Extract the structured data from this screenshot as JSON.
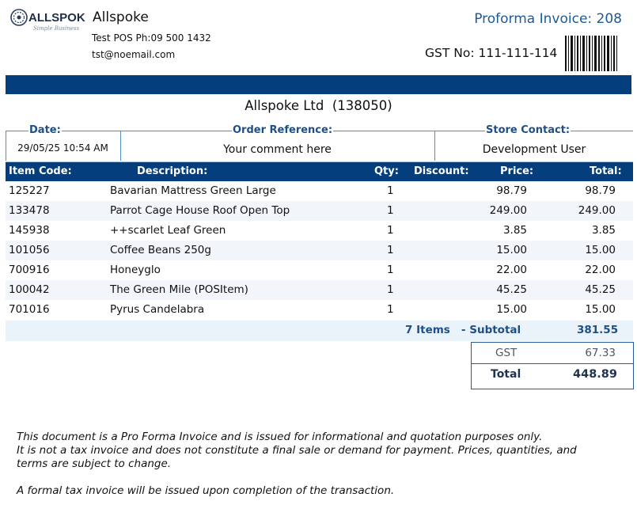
{
  "header": {
    "logo_text": "ALLSPOKE",
    "logo_tagline": "Simple Business",
    "company_name": "Allspoke",
    "phone_line": "Test POS Ph:09 500 1432",
    "email": "tst@noemail.com",
    "invoice_title": "Proforma Invoice: 208",
    "gst_no": "GST No: 111-111-114",
    "barcode_icon": "barcode-icon"
  },
  "customer": {
    "name": "Allspoke Ltd  (138050)"
  },
  "info": {
    "date_label": "Date:",
    "date_value": "29/05/25 10:54 AM",
    "order_ref_label": "Order Reference:",
    "order_ref_value": "Your comment here",
    "store_contact_label": "Store Contact:",
    "store_contact_value": "Development User"
  },
  "table": {
    "headers": {
      "code": "Item Code:",
      "description": "Description:",
      "qty": "Qty:",
      "discount": "Discount:",
      "price": "Price:",
      "total": "Total:"
    },
    "rows": [
      {
        "code": "125227",
        "description": "Bavarian Mattress Green Large",
        "qty": "1",
        "discount": "",
        "price": "98.79",
        "total": "98.79"
      },
      {
        "code": "133478",
        "description": "Parrot Cage House Roof Open Top",
        "qty": "1",
        "discount": "",
        "price": "249.00",
        "total": "249.00"
      },
      {
        "code": "145938",
        "description": "++scarlet Leaf Green",
        "qty": "1",
        "discount": "",
        "price": "3.85",
        "total": "3.85"
      },
      {
        "code": "101056",
        "description": "Coffee Beans 250g",
        "qty": "1",
        "discount": "",
        "price": "15.00",
        "total": "15.00"
      },
      {
        "code": "700916",
        "description": "Honeyglo",
        "qty": "1",
        "discount": "",
        "price": "22.00",
        "total": "22.00"
      },
      {
        "code": "100042",
        "description": "The Green Mile (POSItem)",
        "qty": "1",
        "discount": "",
        "price": "45.25",
        "total": "45.25"
      },
      {
        "code": "701016",
        "description": "Pyrus Candelabra",
        "qty": "1",
        "discount": "",
        "price": "15.00",
        "total": "15.00"
      }
    ]
  },
  "summary": {
    "items_subtotal_label": "7 Items   - Subtotal",
    "subtotal": "381.55",
    "gst_label": "GST",
    "gst_value": "67.33",
    "total_label": "Total",
    "total_value": "448.89"
  },
  "notes": {
    "line1": "This document is a Pro Forma Invoice and is issued for informational and quotation purposes only.",
    "line2": "It is not a tax invoice and does not constitute a final sale or demand for payment. Prices, quantities, and terms are subject to change.",
    "line3": "A formal tax invoice will be issued upon completion of the transaction."
  },
  "colors": {
    "navy": "#053e7d",
    "accent_blue": "#1e5a9a",
    "border_blue": "#4f8ec7"
  }
}
